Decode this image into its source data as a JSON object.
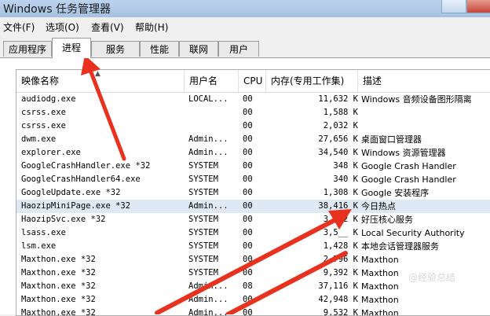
{
  "window": {
    "title": "Windows 任务管理器"
  },
  "menu": {
    "items": [
      "文件(F)",
      "选项(O)",
      "查看(V)",
      "帮助(H)"
    ]
  },
  "tabs": {
    "items": [
      "应用程序",
      "进程",
      "服务",
      "性能",
      "联网",
      "用户"
    ],
    "active": "进程"
  },
  "columns": {
    "name": "映像名称",
    "user": "用户名",
    "cpu": "CPU",
    "memory": "内存(专用工作集)",
    "desc": "描述"
  },
  "rows": [
    {
      "name": "audiodg.exe",
      "user": "LOCAL...",
      "cpu": "00",
      "mem": "11,632 K",
      "desc": "Windows 音频设备图形隔离"
    },
    {
      "name": "csrss.exe",
      "user": "",
      "cpu": "00",
      "mem": "1,588 K",
      "desc": ""
    },
    {
      "name": "csrss.exe",
      "user": "",
      "cpu": "00",
      "mem": "2,032 K",
      "desc": ""
    },
    {
      "name": "dwm.exe",
      "user": "Admin...",
      "cpu": "00",
      "mem": "27,656 K",
      "desc": "桌面窗口管理器"
    },
    {
      "name": "explorer.exe",
      "user": "Admin...",
      "cpu": "00",
      "mem": "34,540 K",
      "desc": "Windows 资源管理器"
    },
    {
      "name": "GoogleCrashHandler.exe *32",
      "user": "SYSTEM",
      "cpu": "00",
      "mem": "348 K",
      "desc": "Google Crash Handler"
    },
    {
      "name": "GoogleCrashHandler64.exe",
      "user": "SYSTEM",
      "cpu": "00",
      "mem": "340 K",
      "desc": "Google Crash Handler"
    },
    {
      "name": "GoogleUpdate.exe *32",
      "user": "SYSTEM",
      "cpu": "00",
      "mem": "1,308 K",
      "desc": "Google 安装程序"
    },
    {
      "name": "HaozipMiniPage.exe *32",
      "user": "Admin...",
      "cpu": "00",
      "mem": "38,416 K",
      "desc": "今日热点"
    },
    {
      "name": "HaozipSvc.exe *32",
      "user": "SYSTEM",
      "cpu": "00",
      "mem": "3,552 K",
      "desc": "好压核心服务"
    },
    {
      "name": "lsass.exe",
      "user": "SYSTEM",
      "cpu": "00",
      "mem": "3,5__ K",
      "desc": "Local Security Authority"
    },
    {
      "name": "lsm.exe",
      "user": "SYSTEM",
      "cpu": "00",
      "mem": "1,428 K",
      "desc": "本地会话管理器服务"
    },
    {
      "name": "Maxthon.exe *32",
      "user": "SYSTEM",
      "cpu": "00",
      "mem": "2,796 K",
      "desc": "Maxthon"
    },
    {
      "name": "Maxthon.exe *32",
      "user": "SYSTEM",
      "cpu": "00",
      "mem": "9,392 K",
      "desc": "Maxthon"
    },
    {
      "name": "Maxthon.exe *32",
      "user": "Admin...",
      "cpu": "08",
      "mem": "37,116 K",
      "desc": "Maxthon"
    },
    {
      "name": "Maxthon.exe *32",
      "user": "Admin...",
      "cpu": "00",
      "mem": "42,948 K",
      "desc": "Maxthon"
    },
    {
      "name": "Maxthon.exe *32",
      "user": "Admin...",
      "cpu": "00",
      "mem": "9,532 K",
      "desc": "Maxthon"
    }
  ],
  "selected_row_name": "HaozipMiniPage.exe *32",
  "watermark": "@经验总结",
  "colors": {
    "arrow": "#e8321f",
    "selection": "#dfe9f6",
    "titlebar": "#b6cdea"
  }
}
